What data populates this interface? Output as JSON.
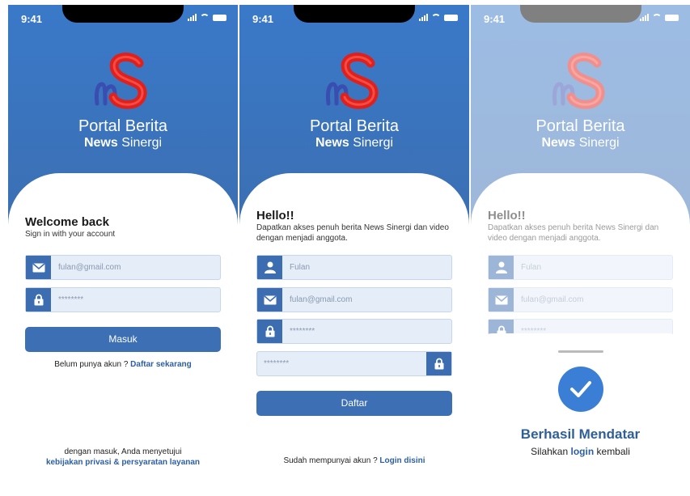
{
  "status": {
    "time": "9:41"
  },
  "brand": {
    "line1": "Portal Berita",
    "news": "News",
    "sinergi": "Sinergi"
  },
  "login": {
    "title": "Welcome back",
    "subtitle": "Sign in with your account",
    "email": "fulan@gmail.com",
    "password": "********",
    "button": "Masuk",
    "register_prompt": "Belum punya akun ?",
    "register_link": "Daftar sekarang",
    "terms_line": "dengan masuk, Anda menyetujui",
    "terms_link": "kebijakan privasi & persyaratan layanan"
  },
  "register": {
    "title": "Hello!!",
    "subtitle": "Dapatkan akses penuh berita News Sinergi dan video dengan menjadi anggota.",
    "name": "Fulan",
    "email": "fulan@gmail.com",
    "password": "********",
    "confirm": "********",
    "button": "Daftar",
    "login_prompt": "Sudah mempunyai akun ?",
    "login_link": "Login disini"
  },
  "success": {
    "title": "Berhasil Mendatar",
    "sub_before": "Silahkan",
    "sub_link": "login",
    "sub_after": "kembali"
  },
  "colors": {
    "accent": "#3c6fb3",
    "link": "#2d5fa4",
    "logo_red": "#e0201c",
    "logo_blue": "#3a4db0"
  }
}
